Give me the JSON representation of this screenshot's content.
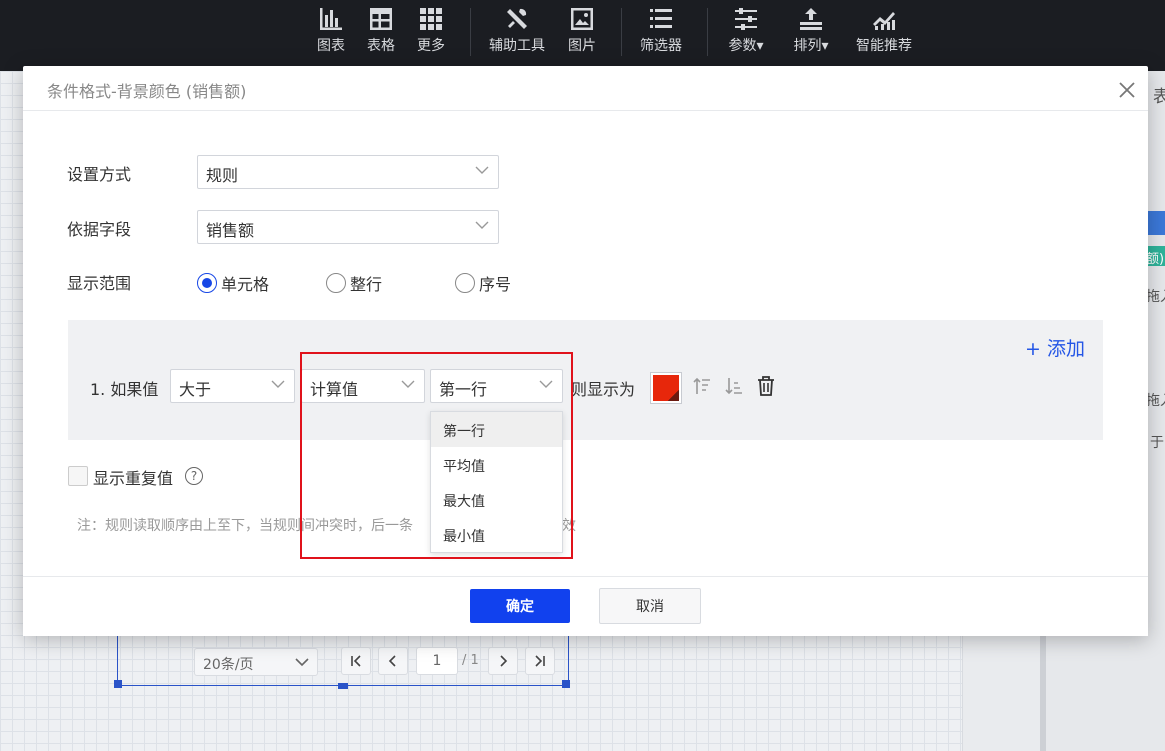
{
  "toolbar": {
    "items": [
      {
        "label": "图表",
        "icon": "bar-chart-icon"
      },
      {
        "label": "表格",
        "icon": "table-icon"
      },
      {
        "label": "更多",
        "icon": "grid-icon"
      },
      {
        "label": "辅助工具",
        "icon": "tools-icon"
      },
      {
        "label": "图片",
        "icon": "image-icon"
      },
      {
        "label": "筛选器",
        "icon": "filter-list-icon"
      },
      {
        "label": "参数▾",
        "icon": "sliders-icon"
      },
      {
        "label": "排列▾",
        "icon": "arrange-icon"
      },
      {
        "label": "智能推荐",
        "icon": "smart-chart-icon"
      }
    ]
  },
  "background": {
    "right_strip_texts": [
      "表",
      "额)",
      "拖入",
      "拖入",
      "于"
    ],
    "pager": {
      "page_size": "20条/页",
      "current_page": "1",
      "total": "/ 1"
    }
  },
  "modal": {
    "title": "条件格式-背景颜色 (销售额)",
    "form": {
      "mode_label": "设置方式",
      "mode_value": "规则",
      "field_label": "依据字段",
      "field_value": "销售额",
      "scope_label": "显示范围",
      "scope_options": [
        "单元格",
        "整行",
        "序号"
      ],
      "scope_selected": "单元格"
    },
    "rule": {
      "add_label": "+ 添加",
      "prefix": "1. 如果值",
      "operator": "大于",
      "value_type": "计算值",
      "calc_value": "第一行",
      "suffix": "则显示为",
      "color": "#e7270b"
    },
    "dropdown_options": [
      "第一行",
      "平均值",
      "最大值",
      "最小值"
    ],
    "dropdown_selected": "第一行",
    "show_duplicates_label": "显示重复值",
    "help_glyph": "?",
    "note_left": "注：规则读取顺序由上至下，当规则间冲突时，后一条",
    "note_right": "效",
    "confirm_label": "确定",
    "cancel_label": "取消"
  },
  "colors": {
    "primary": "#1141ee",
    "link": "#2456e6",
    "highlight_border": "#e0121b",
    "toolbar_bg": "#1b1d22"
  }
}
